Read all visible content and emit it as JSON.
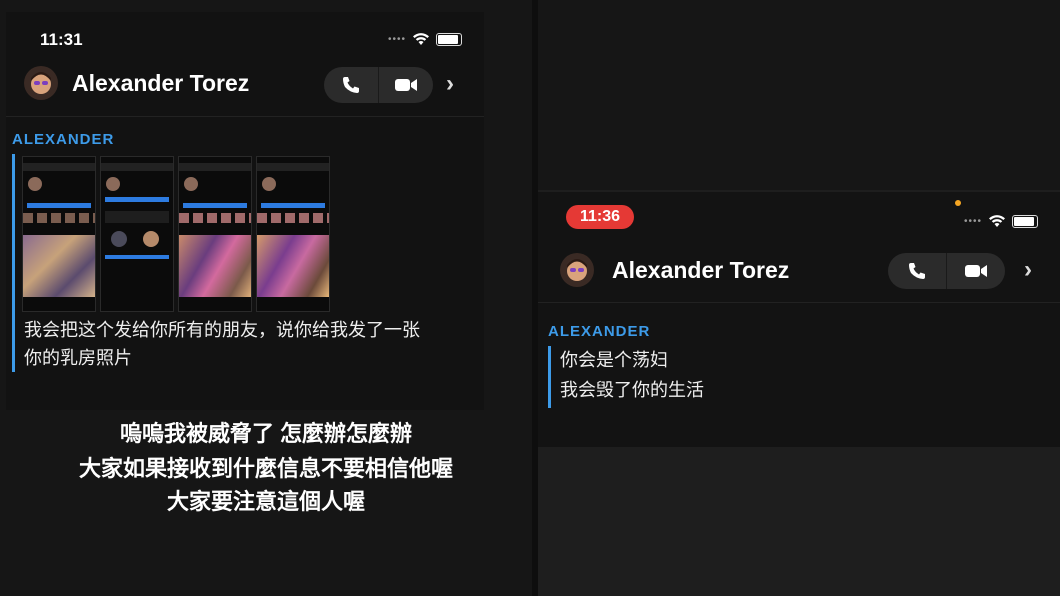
{
  "left": {
    "status_time": "11:31",
    "contact_name": "Alexander Torez",
    "sender_label": "ALEXANDER",
    "message_line1": "我会把这个发给你所有的朋友，说你给我发了一张",
    "message_line2": "你的乳房照片",
    "thumbnails": [
      "profile-screenshot-1",
      "profile-screenshot-2",
      "profile-screenshot-3",
      "profile-screenshot-4"
    ]
  },
  "caption": {
    "line1": "嗚嗚我被威脅了 怎麼辦怎麼辦",
    "line2": "大家如果接收到什麼信息不要相信他喔",
    "line3": "大家要注意這個人喔"
  },
  "right": {
    "status_time": "11:36",
    "contact_name": "Alexander Torez",
    "sender_label": "ALEXANDER",
    "message_line1": "你会是个荡妇",
    "message_line2": "我会毁了你的生活"
  },
  "icons": {
    "call": "phone-icon",
    "video": "video-camera-icon",
    "more": "chevron-right-icon",
    "wifi": "wifi-icon",
    "battery": "battery-icon"
  },
  "colors": {
    "accent": "#3d9be9",
    "recording_pill": "#e53935",
    "background": "#121212"
  }
}
